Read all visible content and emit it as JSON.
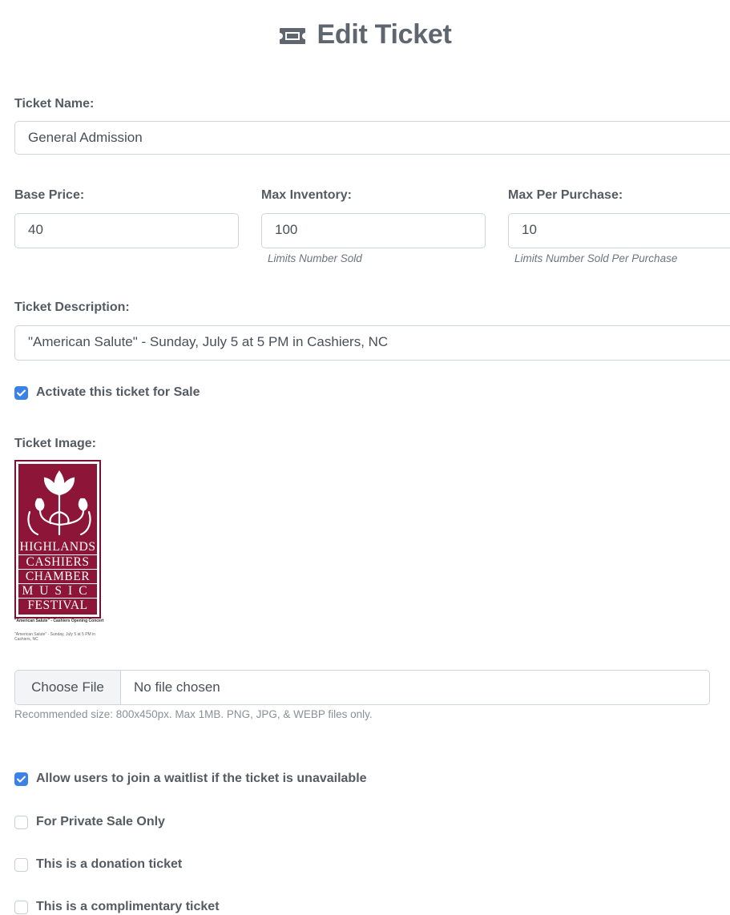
{
  "header": {
    "title": "Edit Ticket",
    "icon": "ticket-icon"
  },
  "form": {
    "ticket_name": {
      "label": "Ticket Name:",
      "value": "General Admission"
    },
    "base_price": {
      "label": "Base Price:",
      "value": "40"
    },
    "max_inventory": {
      "label": "Max Inventory:",
      "value": "100",
      "help": "Limits Number Sold"
    },
    "max_per_purchase": {
      "label": "Max Per Purchase:",
      "value": "10",
      "help": "Limits Number Sold Per Purchase"
    },
    "description": {
      "label": "Ticket Description:",
      "value": "\"American Salute\" - Sunday, July 5 at 5 PM in Cashiers, NC"
    },
    "activate": {
      "label": "Activate this ticket for Sale",
      "checked": true
    },
    "image": {
      "label": "Ticket Image:",
      "logo_lines": [
        "HIGHLANDS",
        "CASHIERS",
        "CHAMBER",
        "MUSIC",
        "FESTIVAL"
      ],
      "caption_title": "\"American Salute\" - Cashiers Opening Concert",
      "caption_desc": "\"American Salute\" - Sunday, July 5 at 5 PM in Cashiers, NC",
      "choose_label": "Choose File",
      "file_status": "No file chosen",
      "hint": "Recommended size: 800x450px. Max 1MB. PNG, JPG, & WEBP files only."
    },
    "waitlist": {
      "label": "Allow users to join a waitlist if the ticket is unavailable",
      "checked": true
    },
    "private_sale": {
      "label": "For Private Sale Only",
      "checked": false
    },
    "donation": {
      "label": "This is a donation ticket",
      "checked": false
    },
    "complimentary": {
      "label": "This is a complimentary ticket",
      "checked": false
    }
  },
  "colors": {
    "accent": "#3b82e6",
    "brand_maroon": "#8c1538",
    "heading": "#5f6670"
  }
}
